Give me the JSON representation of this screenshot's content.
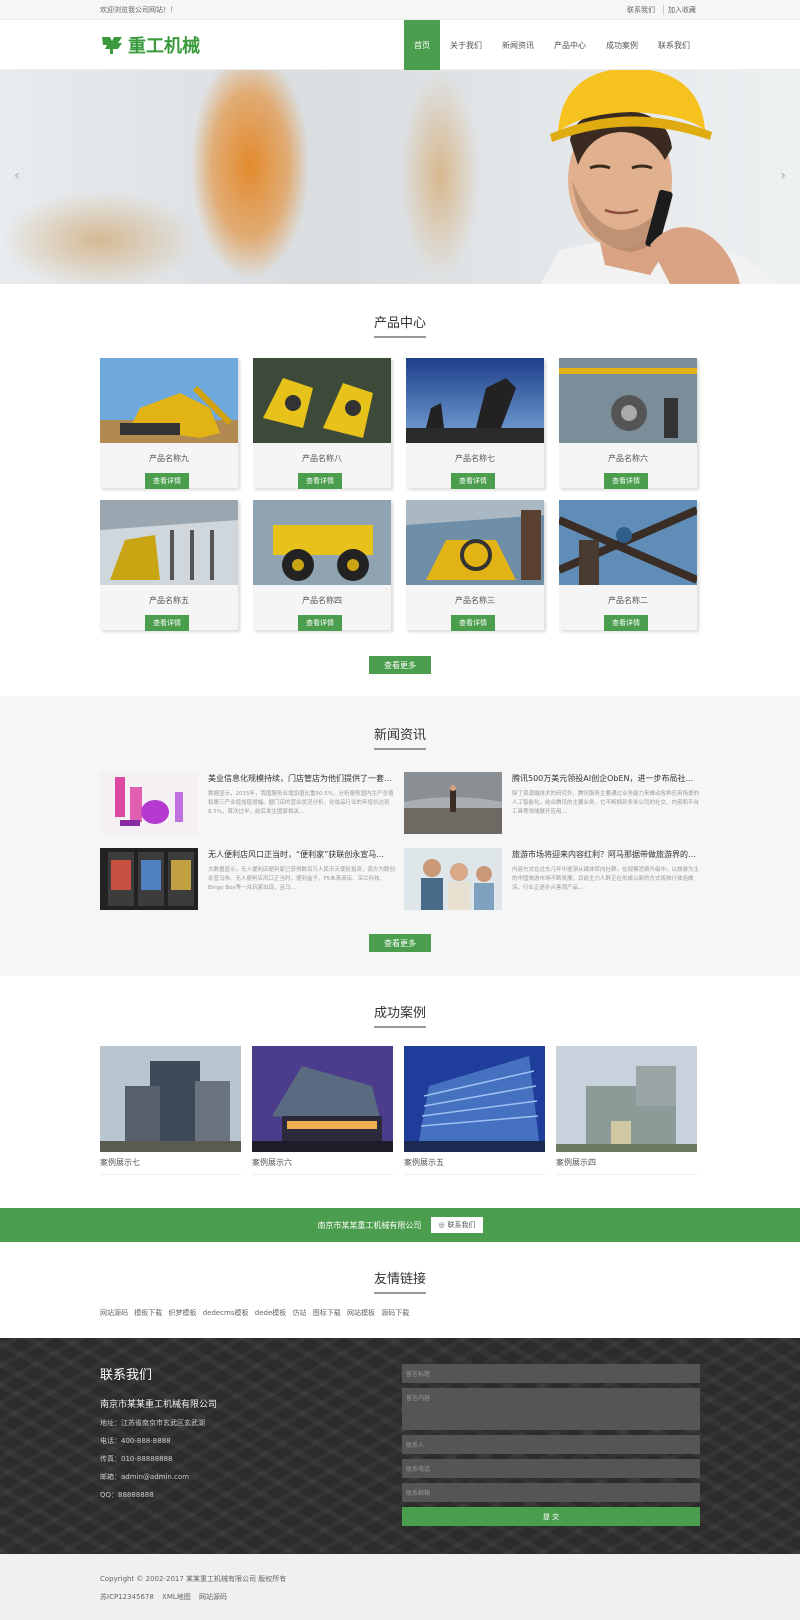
{
  "topbar": {
    "welcome": "欢迎浏览我公司网站！！",
    "contact_link": "联系我们",
    "fav_link": "加入收藏"
  },
  "header": {
    "logo_text": "重工机械",
    "nav": [
      "首页",
      "关于我们",
      "新闻资讯",
      "产品中心",
      "成功案例",
      "联系我们"
    ],
    "active_nav": "首页"
  },
  "banner": {
    "prev": "‹",
    "next": "›"
  },
  "products": {
    "title": "产品中心",
    "items": [
      {
        "name": "产品名称九",
        "btn": "查看详情"
      },
      {
        "name": "产品名称八",
        "btn": "查看详情"
      },
      {
        "name": "产品名称七",
        "btn": "查看详情"
      },
      {
        "name": "产品名称六",
        "btn": "查看详情"
      },
      {
        "name": "产品名称五",
        "btn": "查看详情"
      },
      {
        "name": "产品名称四",
        "btn": "查看详情"
      },
      {
        "name": "产品名称三",
        "btn": "查看详情"
      },
      {
        "name": "产品名称二",
        "btn": "查看详情"
      }
    ],
    "more": "查看更多"
  },
  "news": {
    "title": "新闻资讯",
    "items": [
      {
        "title": "美业信息化规模持续，门店管店为他们提供了一套...",
        "desc": "数据显示，2015年，我国服务业增加值比重50.5%，分析服务国内生产总值和第三产业增加值增幅。据门店的营业状况分析，化妆品行业的年增长达到8.5%，首次过半，前后发生国家相关..."
      },
      {
        "title": "腾讯500万美元领投AI创企ObEN，进一步布局社...",
        "desc": "除了资源端技术的研究外，腾讯服务主要通过业务能力来推动各种应用场景的人工智能化。结合腾讯的主要业务，它不断拥到多米公司的社交、内容和平台工具等领域展开应用..."
      },
      {
        "title": "无人便利店风口正当时，“便利家”获联创永宣马...",
        "desc": "大数据显示，无人便利店便利家已获得数百万人民币天使轮投资，资方为联创永宣马伟、无人便利店风口正当时，便利盒子、F5未来商店、深兰科技、Bingo Box等一众玩家出现，且马..."
      },
      {
        "title": "旅游市场将迎来内容红利？阿马那据带做旅游界的...",
        "desc": "内容方式在过去几年中逐渐从媒体转向社群，在规模消费升级中，以旅游为主的中国旅游市场不断发展，目前主力人群正在形成以新的方式将旅行体验做深，行业正逐步从客观产品..."
      }
    ],
    "more": "查看更多"
  },
  "cases": {
    "title": "成功案例",
    "items": [
      "案例展示七",
      "案例展示六",
      "案例展示五",
      "案例展示四"
    ]
  },
  "contact_bar": {
    "company": "南京市某某重工机械有限公司",
    "btn": "联系我们"
  },
  "links": {
    "title": "友情链接",
    "items": [
      "网站源码",
      "模板下载",
      "织梦模板",
      "dedecms模板",
      "dede模板",
      "仿站",
      "图标下载",
      "网站模板",
      "源码下载"
    ]
  },
  "footer_contact": {
    "title": "联系我们",
    "company": "南京市某某重工机械有限公司",
    "address": "地址：江苏省南京市玄武区玄武湖",
    "phone": "电话：400-888-8888",
    "fax": "传真：010-88888888",
    "email": "邮箱：admin@admin.com",
    "qq": "QQ：88888888",
    "form": {
      "subject": "留言标题",
      "content": "留言内容",
      "name": "联系人",
      "tel": "联系电话",
      "mail": "联系邮箱",
      "submit": "提 交"
    }
  },
  "copyright": {
    "line1": "Copyright © 2002-2017 某某重工机械有限公司 版权所有",
    "icp": "苏ICP12345678",
    "sitemap": "XML地图",
    "source": "网站源码"
  },
  "colors": {
    "accent": "#4b9e4d",
    "footer_bg": "#2c2c2c"
  }
}
